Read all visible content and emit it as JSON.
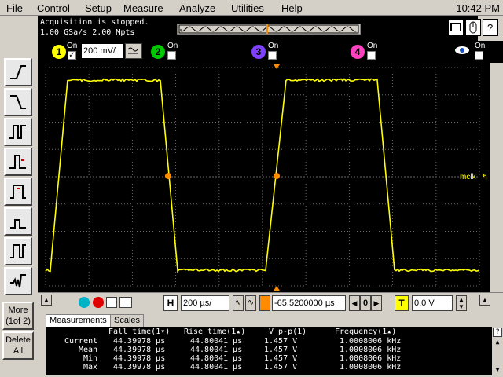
{
  "menu": {
    "items": [
      "File",
      "Control",
      "Setup",
      "Measure",
      "Analyze",
      "Utilities",
      "Help"
    ],
    "clock": "10:42 PM"
  },
  "status": {
    "line1": "Acquisition is stopped.",
    "line2": "1.00 GSa/s   2.00 Mpts"
  },
  "channels": [
    {
      "num": "1",
      "on_label": "On",
      "checked": true,
      "color": "#ffff00"
    },
    {
      "num": "2",
      "on_label": "On",
      "checked": false,
      "color": "#00c800"
    },
    {
      "num": "3",
      "on_label": "On",
      "checked": false,
      "color": "#8040ff"
    },
    {
      "num": "4",
      "on_label": "On",
      "checked": false,
      "color": "#ff40c0"
    }
  ],
  "ch1_scale": "200 mV/",
  "eye_label": "On",
  "trace_label": "mclk",
  "left_buttons": {
    "more": "More",
    "more_sub": "(1of 2)",
    "delete": "Delete",
    "delete_sub": "All"
  },
  "controls": {
    "h_tag": "H",
    "timebase": "200 µs/",
    "position": "-65.5200000 µs",
    "zero_btn": "0",
    "t_tag": "T",
    "trigger_level": "0.0 V"
  },
  "tabs": [
    "Measurements",
    "Scales"
  ],
  "measurements": {
    "headers": [
      "Fall time(1▾)",
      "Rise time(1▴)",
      "V p-p(1)",
      "Frequency(1▴)"
    ],
    "rows": [
      {
        "label": "Current",
        "values": [
          "44.39978 µs",
          "44.80041 µs",
          "1.457 V",
          "1.0008006 kHz"
        ]
      },
      {
        "label": "Mean",
        "values": [
          "44.39978 µs",
          "44.80041 µs",
          "1.457 V",
          "1.0008006 kHz"
        ]
      },
      {
        "label": "Min",
        "values": [
          "44.39978 µs",
          "44.80041 µs",
          "1.457 V",
          "1.0008006 kHz"
        ]
      },
      {
        "label": "Max",
        "values": [
          "44.39978 µs",
          "44.80041 µs",
          "1.457 V",
          "1.0008006 kHz"
        ]
      }
    ]
  },
  "colors": {
    "trace": "#ffff00",
    "marker": "#ff8c00",
    "grid": "#6a6a6a",
    "background": "#000000"
  },
  "icons": [
    "rising-edge-icon",
    "falling-edge-icon",
    "pulse-width-icon",
    "glitch-icon",
    "setup-hold-icon",
    "runt-icon",
    "transition-icon",
    "timeout-icon",
    "run-icon",
    "stop-icon",
    "single-icon",
    "print-icon",
    "help-icon"
  ]
}
